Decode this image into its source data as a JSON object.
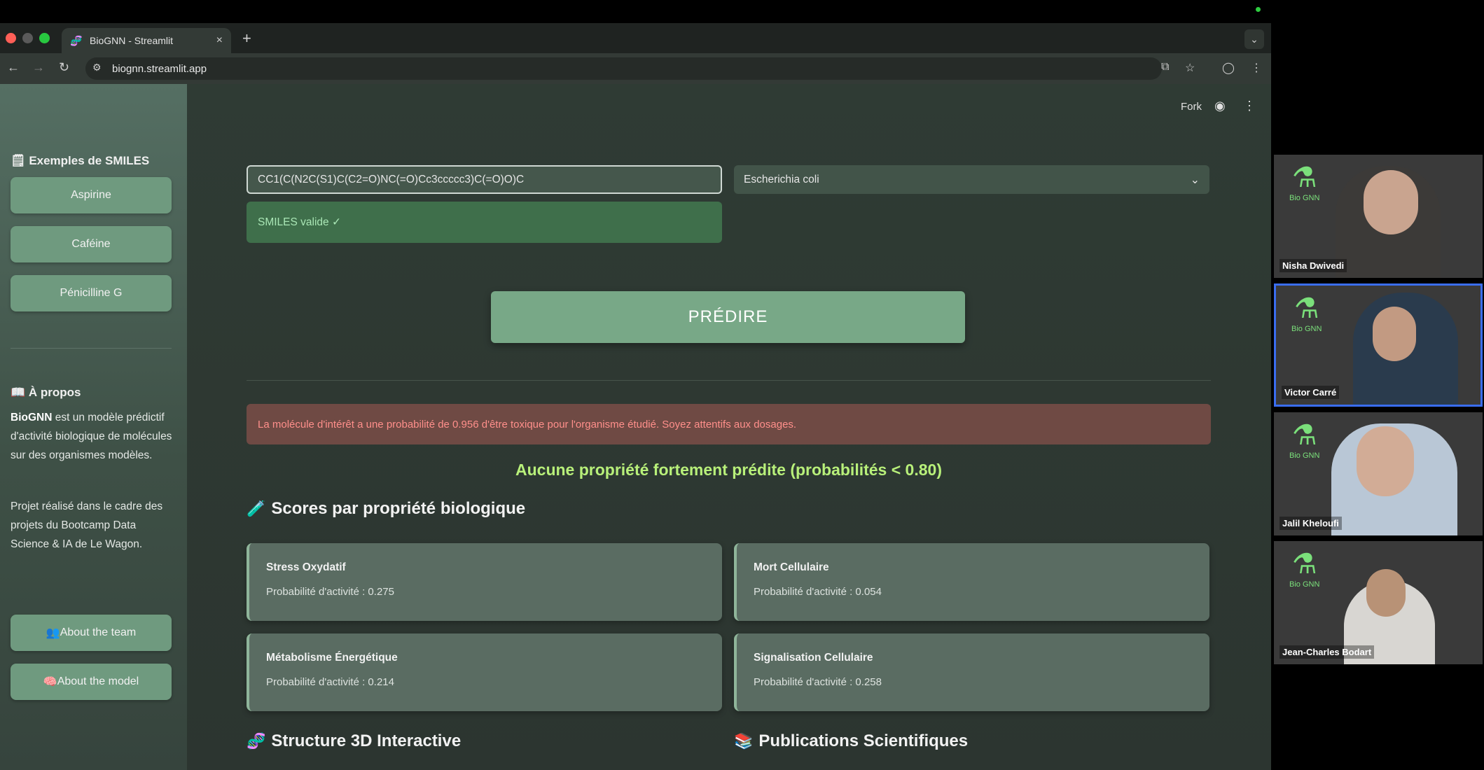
{
  "browser": {
    "tab_title": "BioGNN - Streamlit",
    "url": "biognn.streamlit.app",
    "new_tab_symbol": "+",
    "tab_close_symbol": "×"
  },
  "header": {
    "fork_label": "Fork"
  },
  "sidebar": {
    "examples_heading": "Exemples de SMILES",
    "examples": [
      {
        "label": "Aspirine"
      },
      {
        "label": "Caféine"
      },
      {
        "label": "Pénicilline G"
      }
    ],
    "about_heading": "À propos",
    "about_brand": "BioGNN",
    "about_text": " est un modèle prédictif d'activité biologique de molécules sur des organismes modèles.",
    "project_text": "Projet réalisé dans le cadre des projets du Bootcamp Data Science & IA de Le Wagon.",
    "team_button": "About the team",
    "model_button": "About the model"
  },
  "main": {
    "smiles_value": "CC1(C(N2C(S1)C(C2=O)NC(=O)Cc3ccccc3)C(=O)O)C",
    "organism_selected": "Escherichia coli",
    "validation_text": "SMILES valide ✓",
    "predict_label": "PRÉDIRE",
    "toxicity_alert": "La molécule d'intérêt a une probabilité de 0.956 d'être toxique pour l'organisme étudié. Soyez attentifs aux dosages.",
    "no_property_text": "Aucune propriété fortement prédite (probabilités < 0.80)",
    "scores_heading": "Scores par propriété biologique",
    "scores": [
      {
        "title": "Stress Oxydatif",
        "prob": "Probabilité d'activité : 0.275"
      },
      {
        "title": "Mort Cellulaire",
        "prob": "Probabilité d'activité : 0.054"
      },
      {
        "title": "Métabolisme Énergétique",
        "prob": "Probabilité d'activité : 0.214"
      },
      {
        "title": "Signalisation Cellulaire",
        "prob": "Probabilité d'activité : 0.258"
      }
    ],
    "structure_heading": "Structure 3D Interactive",
    "publications_heading": "Publications Scientifiques"
  },
  "call": {
    "participants": [
      {
        "name": "Nisha Dwivedi",
        "logo": "Bio GNN"
      },
      {
        "name": "Victor Carré",
        "logo": "Bio GNN"
      },
      {
        "name": "Jalil Kheloufi",
        "logo": "Bio GNN"
      },
      {
        "name": "Jean-Charles Bodart",
        "logo": "Bio GNN"
      }
    ]
  },
  "colors": {
    "accent_green": "#b8f07a",
    "button_green": "#78a887",
    "alert_red": "#ff8f8b",
    "active_speaker": "#3a6df0"
  }
}
